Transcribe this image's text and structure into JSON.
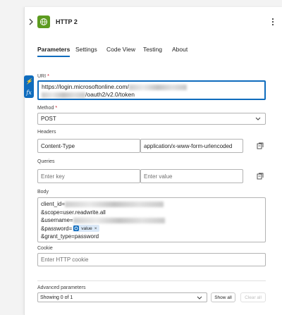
{
  "header": {
    "title": "HTTP 2",
    "icon": "globe-icon",
    "accent": "#5c9b1f"
  },
  "tabs": [
    "Parameters",
    "Settings",
    "Code View",
    "Testing",
    "About"
  ],
  "uri": {
    "label": "URI",
    "required_mark": "*",
    "line1": "https://login.microsoftonline.com/",
    "line2": "/oauth2/v2.0/token"
  },
  "method": {
    "label": "Method",
    "required_mark": "*",
    "value": "POST"
  },
  "headers": {
    "label": "Headers",
    "key": "Content-Type",
    "value": "application/x-www-form-urlencoded"
  },
  "queries": {
    "label": "Queries",
    "key_placeholder": "Enter key",
    "value_placeholder": "Enter value"
  },
  "body": {
    "label": "Body",
    "line1": "client_id=",
    "line2": "&scope=user.readwrite.all",
    "line3": "&username=",
    "line4": "&password=",
    "token_label": "value",
    "token_close": "×",
    "line5": "&grant_type=password"
  },
  "cookie": {
    "label": "Cookie",
    "placeholder": "Enter HTTP cookie"
  },
  "advanced": {
    "label": "Advanced parameters",
    "select_value": "Showing 0 of 1",
    "show_all": "Show all",
    "clear_all": "Clear all"
  }
}
